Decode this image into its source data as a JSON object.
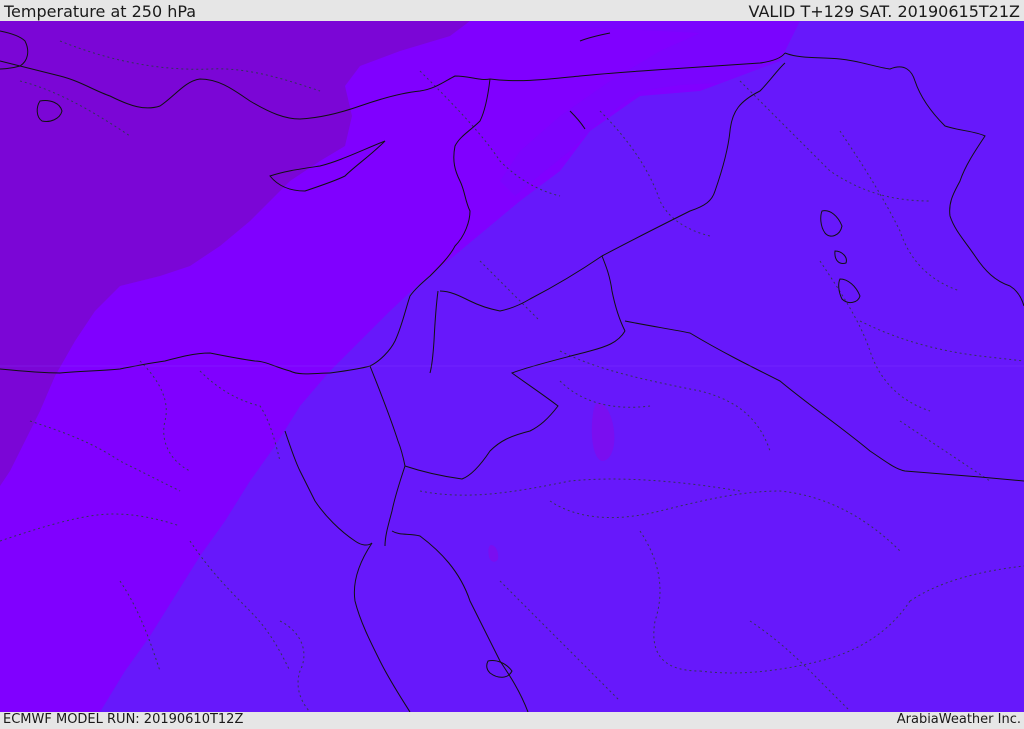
{
  "header": {
    "title": "Temperature at 250 hPa",
    "valid": "VALID T+129 SAT. 20190615T21Z"
  },
  "footer": {
    "model_run": "ECMWF MODEL RUN: 20190610T12Z",
    "credit": "ArabiaWeather Inc."
  },
  "map": {
    "colors": {
      "zone_coldest": "#7b06d6",
      "zone_cold": "#8000ff",
      "zone_mid": "#7408fd",
      "zone_base": "#6718fb",
      "border": "#111111",
      "province": "#333355"
    }
  }
}
